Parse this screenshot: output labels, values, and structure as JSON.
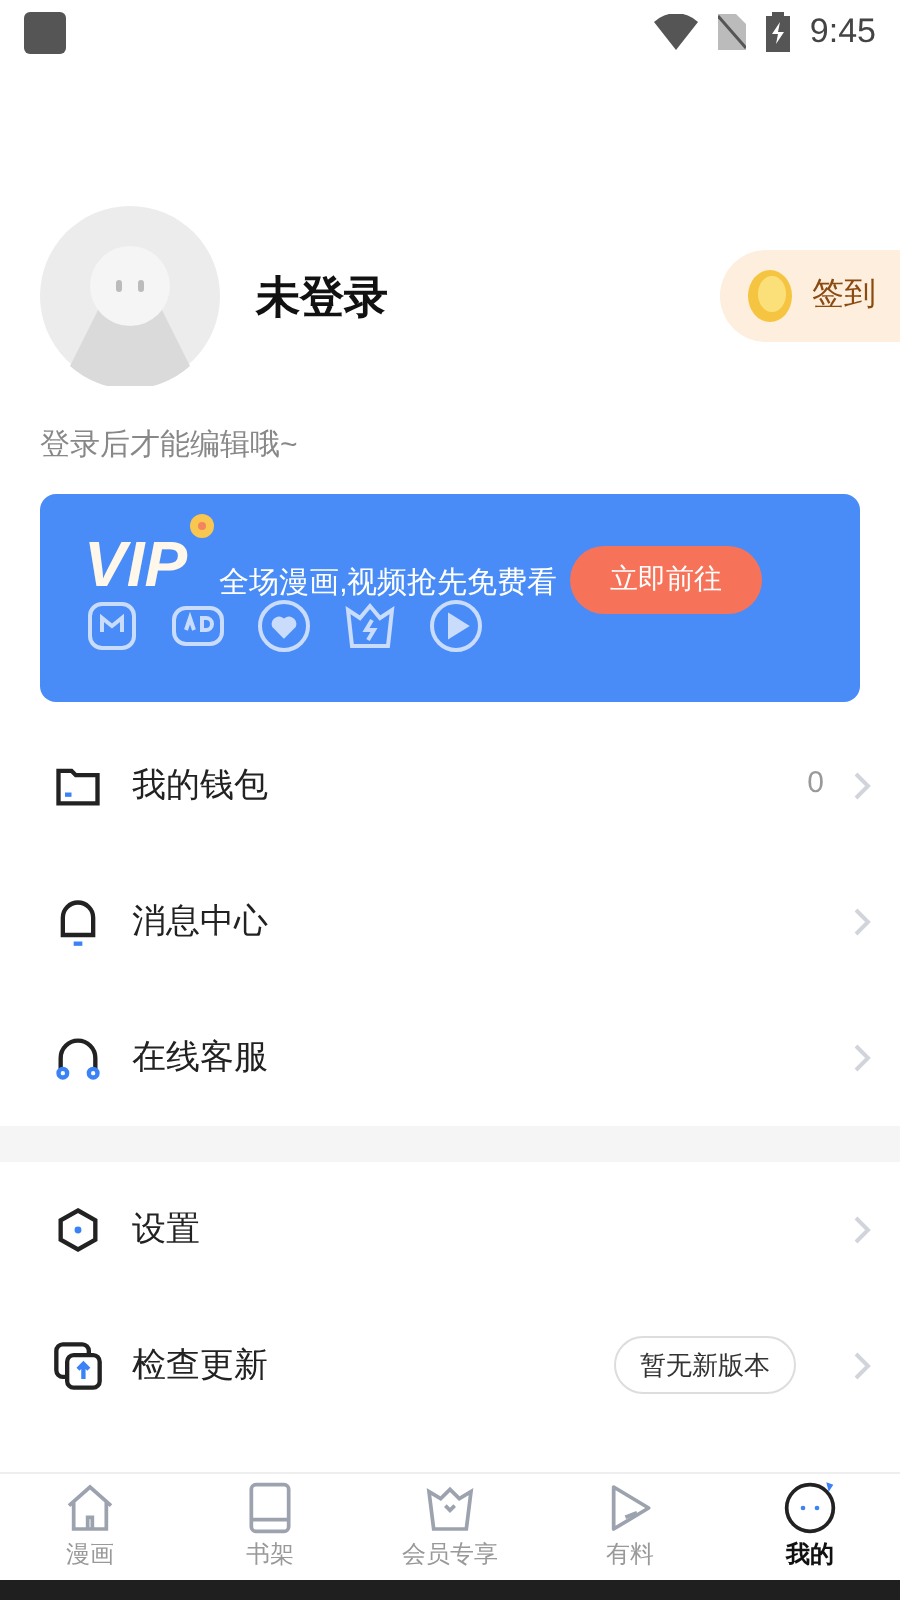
{
  "status_bar": {
    "time": "9:45"
  },
  "profile": {
    "name": "未登录",
    "sign_in": "签到",
    "hint": "登录后才能编辑哦~"
  },
  "vip": {
    "logo": "VIP",
    "slogan": "全场漫画,视频抢先免费看",
    "button": "立即前往"
  },
  "menu_groups": [
    [
      {
        "kind": "wallet",
        "label": "我的钱包",
        "value": "0"
      },
      {
        "kind": "bell",
        "label": "消息中心"
      },
      {
        "kind": "headset",
        "label": "在线客服"
      }
    ],
    [
      {
        "kind": "settings",
        "label": "设置"
      },
      {
        "kind": "update",
        "label": "检查更新",
        "badge": "暂无新版本"
      }
    ]
  ],
  "nav": [
    {
      "kind": "home",
      "label": "漫画",
      "selected": false
    },
    {
      "kind": "book",
      "label": "书架",
      "selected": false
    },
    {
      "kind": "crown",
      "label": "会员专享",
      "selected": false
    },
    {
      "kind": "play",
      "label": "有料",
      "selected": false
    },
    {
      "kind": "face",
      "label": "我的",
      "selected": true
    }
  ]
}
